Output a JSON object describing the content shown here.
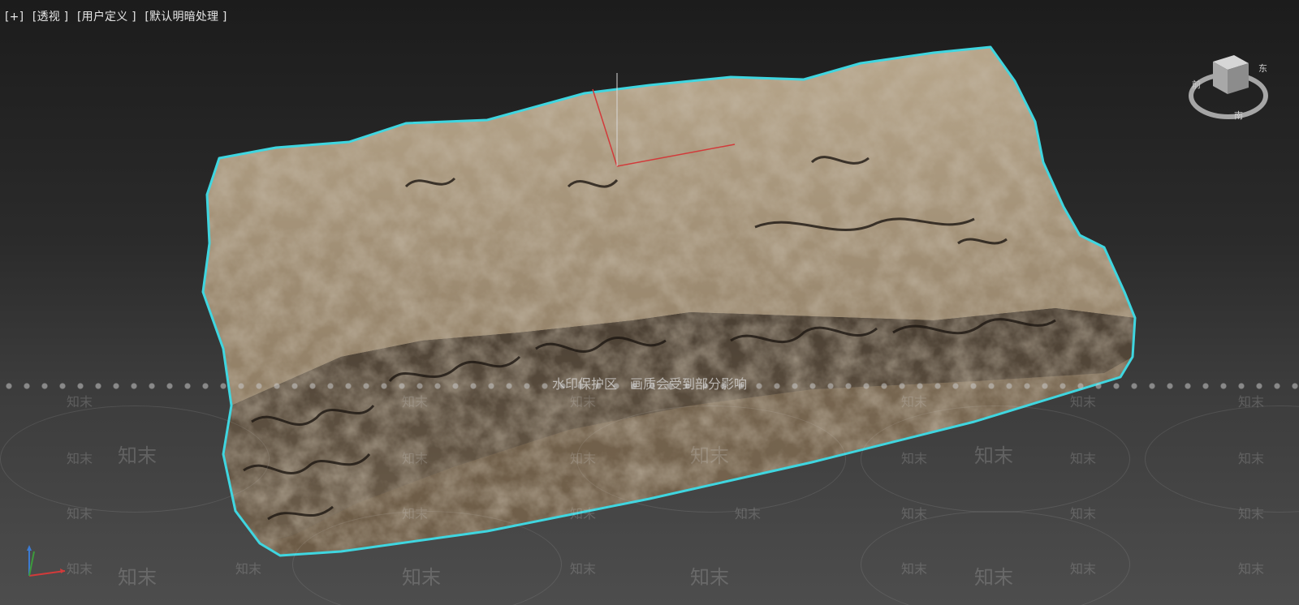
{
  "viewport": {
    "labels": [
      "[+]",
      "[透视 ]",
      "[用户定义 ]",
      "[默认明暗处理 ]"
    ]
  },
  "overlay": {
    "watermark_notice": "水印保护区　画质会受到部分影响",
    "watermark_brand": "知末"
  },
  "navcube": {
    "icon": "view-cube-icon",
    "labels": [
      "前",
      "东",
      "南"
    ]
  },
  "axis_tripod": {
    "icon": "axis-tripod-icon"
  },
  "colors": {
    "selection_outline": "#3fd6e0",
    "gizmo_x": "#d23a3a",
    "gizmo_y": "#3c9a3c",
    "gizmo_z": "#d8d8d8"
  }
}
